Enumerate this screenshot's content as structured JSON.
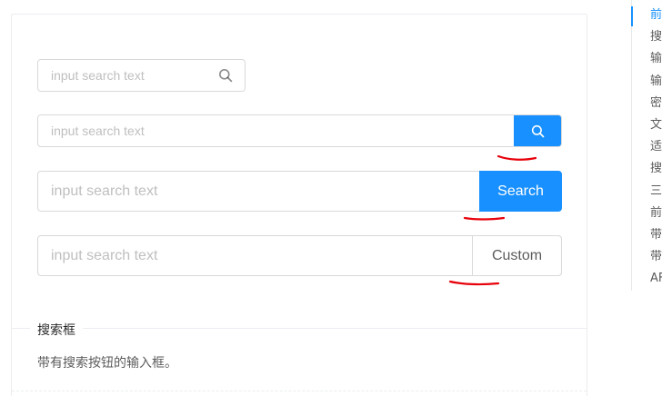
{
  "demo": {
    "search1": {
      "placeholder": "input search text",
      "icon": "search-icon"
    },
    "search2": {
      "placeholder": "input search text",
      "button_icon": "search-icon"
    },
    "search3": {
      "placeholder": "input search text",
      "button_label": "Search"
    },
    "search4": {
      "placeholder": "input search text",
      "button_label": "Custom"
    },
    "title": "搜索框",
    "description": "带有搜索按钮的输入框。"
  },
  "anchor": {
    "items": [
      "前",
      "搜",
      "输",
      "输",
      "密",
      "文",
      "适",
      "搜",
      "三",
      "前",
      "带",
      "带",
      "AF"
    ],
    "active_index": 0
  },
  "colors": {
    "primary": "#1890ff",
    "annotation": "#e8000a",
    "border": "#d9d9d9",
    "placeholder": "#bfbfbf"
  }
}
